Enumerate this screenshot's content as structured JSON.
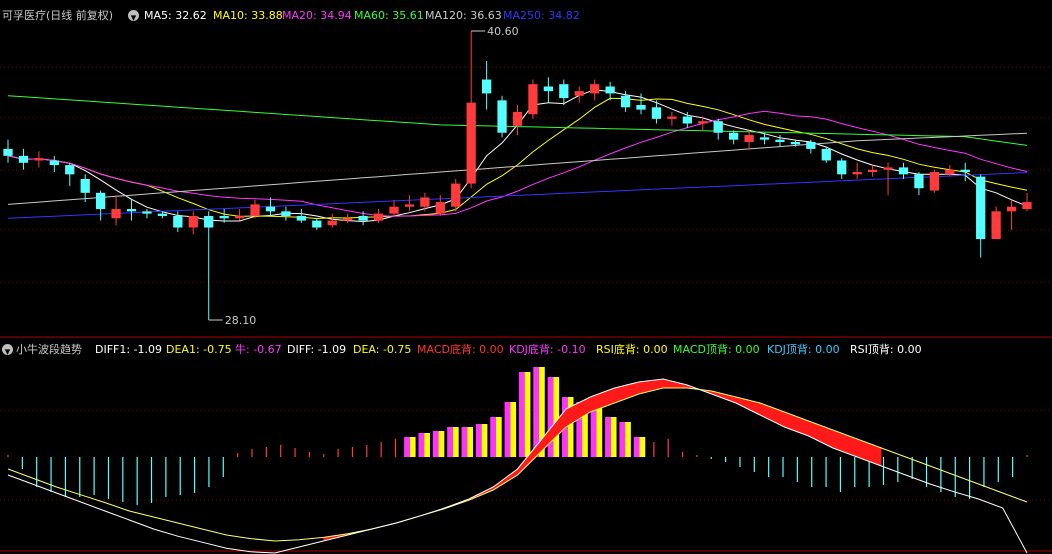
{
  "stock": {
    "name": "可孚医疗",
    "period": "(日线 前复权)",
    "dropdown_icon": "chevron-down-icon"
  },
  "ma_legend": [
    {
      "label": "MA5: 32.62",
      "color": "#ffffff"
    },
    {
      "label": "MA10: 33.88",
      "color": "#ffff00"
    },
    {
      "label": "MA20: 34.94",
      "color": "#ff33ff"
    },
    {
      "label": "MA60: 35.61",
      "color": "#33ff33"
    },
    {
      "label": "MA120: 36.63",
      "color": "#c8c8c8"
    },
    {
      "label": "MA250: 34.82",
      "color": "#3333ff"
    }
  ],
  "price_marks": {
    "high": "40.60",
    "low": "28.10"
  },
  "indicator": {
    "name": "小牛波段趋势",
    "values": [
      {
        "label": "DIFF1: -1.09",
        "color": "#ffffff"
      },
      {
        "label": "DEA1: -0.75",
        "color": "#ffff00"
      },
      {
        "label": "牛: -0.67",
        "color": "#ff33ff"
      },
      {
        "label": "DIFF: -1.09",
        "color": "#ffffff"
      },
      {
        "label": "DEA: -0.75",
        "color": "#ffff00"
      },
      {
        "label": "MACD底背: 0.00",
        "color": "#ff3333"
      },
      {
        "label": "KDJ底背: -0.10",
        "color": "#ff33ff"
      },
      {
        "label": "RSI底背: 0.00",
        "color": "#ffff00"
      },
      {
        "label": "MACD顶背: 0.00",
        "color": "#33ff33"
      },
      {
        "label": "KDJ顶背: 0.00",
        "color": "#33ccff"
      },
      {
        "label": "RSI顶背: 0.00",
        "color": "#ffffff"
      }
    ]
  },
  "colors": {
    "up": "#ff3b3b",
    "down": "#54ffff",
    "grid": "#7a0000",
    "divider": "#b00000"
  },
  "chart_data": {
    "type": "candlestick",
    "price_range": [
      28.1,
      40.6
    ],
    "candles": [
      [
        35.5,
        35.2,
        35.9,
        34.9
      ],
      [
        35.2,
        34.9,
        35.5,
        34.6
      ],
      [
        35.0,
        35.1,
        35.4,
        34.7
      ],
      [
        35.0,
        34.8,
        35.2,
        34.5
      ],
      [
        34.8,
        34.4,
        34.9,
        33.9
      ],
      [
        34.2,
        33.6,
        34.4,
        33.2
      ],
      [
        33.6,
        32.9,
        33.7,
        32.4
      ],
      [
        32.5,
        32.9,
        33.5,
        32.2
      ],
      [
        32.9,
        32.8,
        33.3,
        32.4
      ],
      [
        32.8,
        32.7,
        32.9,
        32.5
      ],
      [
        32.7,
        32.6,
        32.8,
        32.5
      ],
      [
        32.6,
        32.1,
        32.8,
        31.9
      ],
      [
        32.1,
        32.6,
        32.8,
        31.8
      ],
      [
        32.6,
        32.1,
        32.8,
        28.1
      ],
      [
        32.6,
        32.5,
        32.9,
        32.3
      ],
      [
        32.5,
        32.6,
        32.9,
        32.4
      ],
      [
        32.6,
        33.1,
        33.3,
        32.5
      ],
      [
        33.0,
        32.8,
        33.4,
        32.6
      ],
      [
        32.8,
        32.6,
        33.0,
        32.4
      ],
      [
        32.6,
        32.4,
        32.9,
        32.3
      ],
      [
        32.4,
        32.1,
        32.5,
        32.0
      ],
      [
        32.2,
        32.4,
        32.7,
        32.1
      ],
      [
        32.4,
        32.5,
        32.7,
        32.3
      ],
      [
        32.6,
        32.4,
        32.8,
        32.2
      ],
      [
        32.4,
        32.7,
        32.9,
        32.3
      ],
      [
        32.7,
        33.0,
        33.3,
        32.6
      ],
      [
        33.0,
        33.1,
        33.5,
        32.8
      ],
      [
        33.0,
        33.4,
        33.6,
        32.8
      ],
      [
        32.7,
        33.2,
        33.5,
        32.6
      ],
      [
        33.0,
        34.0,
        34.2,
        32.8
      ],
      [
        34.0,
        37.5,
        40.6,
        33.8
      ],
      [
        38.5,
        37.9,
        39.3,
        37.2
      ],
      [
        37.6,
        36.2,
        37.8,
        36.0
      ],
      [
        36.5,
        37.1,
        37.4,
        36.1
      ],
      [
        37.0,
        38.3,
        38.5,
        36.8
      ],
      [
        38.2,
        38.0,
        38.6,
        37.5
      ],
      [
        38.3,
        37.7,
        38.5,
        37.4
      ],
      [
        37.8,
        38.0,
        38.2,
        37.5
      ],
      [
        37.9,
        38.3,
        38.5,
        37.6
      ],
      [
        38.2,
        37.9,
        38.4,
        37.6
      ],
      [
        37.8,
        37.3,
        38.0,
        37.1
      ],
      [
        37.4,
        37.2,
        37.9,
        37.0
      ],
      [
        37.3,
        36.8,
        37.6,
        36.6
      ],
      [
        36.8,
        36.9,
        37.1,
        36.5
      ],
      [
        36.9,
        36.6,
        37.1,
        36.4
      ],
      [
        36.6,
        36.7,
        36.9,
        36.3
      ],
      [
        36.7,
        36.2,
        36.8,
        35.9
      ],
      [
        36.2,
        35.9,
        36.3,
        35.7
      ],
      [
        35.8,
        36.1,
        36.3,
        35.5
      ],
      [
        36.0,
        35.9,
        36.2,
        35.7
      ],
      [
        35.9,
        35.8,
        36.1,
        35.6
      ],
      [
        35.8,
        35.7,
        35.9,
        35.6
      ],
      [
        35.8,
        35.5,
        35.9,
        35.3
      ],
      [
        35.5,
        35.0,
        35.6,
        34.9
      ],
      [
        35.0,
        34.4,
        35.1,
        34.2
      ],
      [
        34.4,
        34.5,
        34.9,
        34.2
      ],
      [
        34.5,
        34.6,
        34.8,
        34.3
      ],
      [
        34.6,
        34.7,
        34.9,
        33.5
      ],
      [
        34.7,
        34.4,
        34.9,
        34.2
      ],
      [
        34.4,
        33.8,
        34.5,
        33.5
      ],
      [
        33.7,
        34.5,
        34.6,
        33.6
      ],
      [
        34.4,
        34.6,
        34.8,
        34.3
      ],
      [
        34.6,
        34.5,
        34.9,
        34.1
      ],
      [
        34.3,
        31.6,
        34.4,
        30.8
      ],
      [
        31.6,
        32.8,
        33.0,
        31.6
      ],
      [
        32.8,
        33.0,
        33.3,
        32.0
      ],
      [
        32.9,
        33.2,
        33.6,
        32.8
      ]
    ],
    "macd_bars": [
      0.02,
      -0.12,
      -0.3,
      -0.35,
      -0.4,
      -0.4,
      -0.38,
      -0.42,
      -0.45,
      -0.48,
      -0.46,
      -0.4,
      -0.38,
      -0.36,
      -0.3,
      -0.2,
      0.04,
      0.08,
      0.1,
      0.12,
      0.09,
      0.05,
      0.03,
      0.08,
      0.1,
      0.12,
      0.15,
      0.18,
      0.2,
      0.24,
      0.26,
      0.3,
      0.3,
      0.33,
      0.4,
      0.55,
      0.85,
      0.9,
      0.8,
      0.6,
      0.55,
      0.5,
      0.4,
      0.35,
      0.2,
      0.15,
      0.18,
      0.05,
      0.02,
      -0.02,
      -0.05,
      -0.1,
      -0.15,
      -0.2,
      -0.2,
      -0.25,
      -0.3,
      -0.3,
      -0.35,
      -0.3,
      -0.3,
      -0.28,
      -0.25,
      -0.22,
      -0.3,
      -0.35,
      -0.4,
      -0.42,
      -0.3,
      -0.25,
      -0.2,
      0.02
    ],
    "diff": [
      -0.3,
      -0.45,
      -0.6,
      -0.75,
      -0.9,
      -1.05,
      -1.2,
      -1.32,
      -1.42,
      -1.52,
      -1.58,
      -1.6,
      -1.5,
      -1.4,
      -1.3,
      -1.2,
      -1.1,
      -0.98,
      -0.85,
      -0.7,
      -0.5,
      -0.2,
      0.3,
      0.8,
      1.0,
      1.15,
      1.25,
      1.3,
      1.2,
      1.05,
      0.9,
      0.7,
      0.5,
      0.35,
      0.15,
      0.0,
      -0.15,
      -0.3,
      -0.45,
      -0.58,
      -0.7,
      -0.85,
      -1.6
    ],
    "dea": [
      -0.2,
      -0.35,
      -0.5,
      -0.63,
      -0.76,
      -0.9,
      -1.0,
      -1.1,
      -1.2,
      -1.3,
      -1.36,
      -1.4,
      -1.38,
      -1.34,
      -1.28,
      -1.2,
      -1.1,
      -0.98,
      -0.86,
      -0.72,
      -0.55,
      -0.3,
      0.1,
      0.5,
      0.75,
      0.9,
      1.05,
      1.15,
      1.15,
      1.1,
      1.0,
      0.9,
      0.75,
      0.6,
      0.45,
      0.3,
      0.15,
      0.0,
      -0.15,
      -0.3,
      -0.45,
      -0.6,
      -0.75
    ],
    "bars_count": 72
  }
}
